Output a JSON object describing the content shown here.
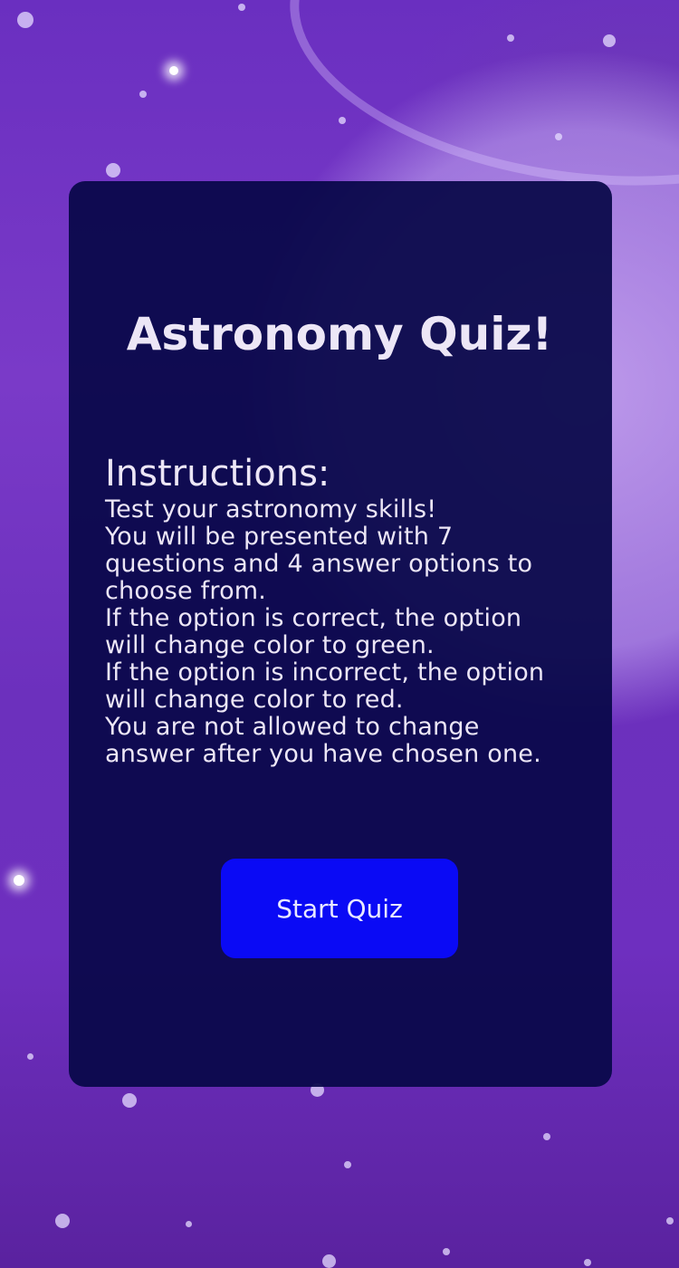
{
  "title": "Astronomy Quiz!",
  "instructions": {
    "heading": "Instructions:",
    "lines": [
      "Test your astronomy skills!",
      "You will be presented with 7",
      "questions and 4 answer options to",
      "choose from.",
      "If the option is correct, the option",
      "will change color to green.",
      "If the option is incorrect, the option",
      "will change color to red.",
      "You are not allowed to change",
      "answer after you have chosen one."
    ]
  },
  "start_button": {
    "label": "Start Quiz"
  },
  "colors": {
    "card_background": "#080848",
    "button": "#0a0af5",
    "text": "#ece6f6",
    "page_background": "#6a2fc0"
  }
}
